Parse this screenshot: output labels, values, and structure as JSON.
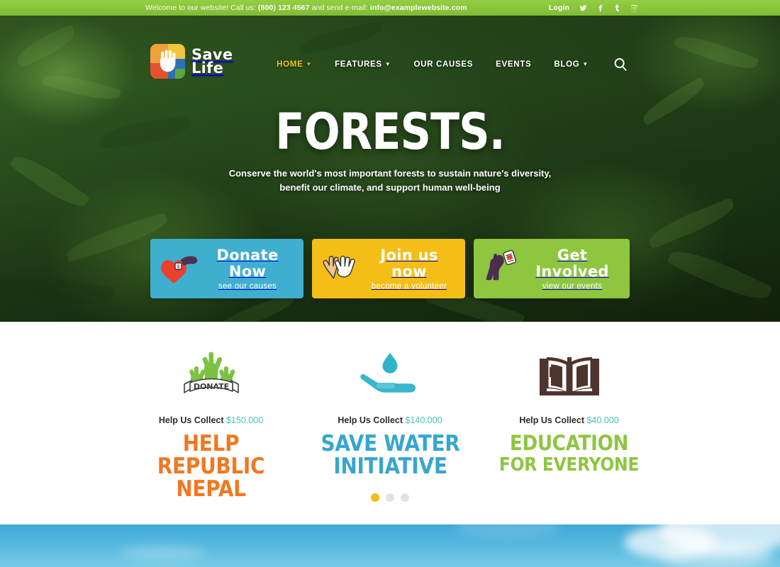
{
  "topbar": {
    "welcome_prefix": "Welcome to our website! Call us: ",
    "phone": "(800) 123 4567",
    "welcome_mid": " and send e-mail: ",
    "email": "info@examplewebsite.com",
    "login_label": "Login",
    "social": [
      {
        "name": "twitter-icon",
        "label": "Twitter"
      },
      {
        "name": "facebook-icon",
        "label": "Facebook"
      },
      {
        "name": "tumblr-icon",
        "label": "Tumblr"
      },
      {
        "name": "instagram-icon",
        "label": "Instagram"
      }
    ],
    "bg_color": "#8dc63f"
  },
  "header": {
    "logo": {
      "line1": "Save",
      "line2": "Life",
      "icon": "hand-logo-icon"
    },
    "nav": [
      {
        "label": "HOME",
        "has_dropdown": true,
        "active": true
      },
      {
        "label": "FEATURES",
        "has_dropdown": true,
        "active": false
      },
      {
        "label": "OUR CAUSES",
        "has_dropdown": false,
        "active": false
      },
      {
        "label": "EVENTS",
        "has_dropdown": false,
        "active": false
      },
      {
        "label": "BLOG",
        "has_dropdown": true,
        "active": false
      }
    ],
    "search_icon": "search-icon",
    "active_color": "#f3c518"
  },
  "hero": {
    "title": "FORESTS.",
    "subtitle_line1": "Conserve the world's most important forests to sustain nature's diversity,",
    "subtitle_line2": "benefit our climate, and support human well-being",
    "cards": [
      {
        "title": "Donate Now",
        "subtitle": "see our causes",
        "color": "#3fafd0",
        "icon": "heart-donate-icon"
      },
      {
        "title": "Join us now",
        "subtitle": "become a volunteer",
        "color": "#f5be16",
        "icon": "clapping-hands-icon"
      },
      {
        "title": "Get Involved",
        "subtitle": "view our events",
        "color": "#8ec63f",
        "icon": "dog-tag-icon"
      }
    ]
  },
  "causes": {
    "collect_label": "Help Us Collect",
    "items": [
      {
        "icon": "donate-hands-ribbon-icon",
        "amount": "$150.000",
        "title_line1": "HELP REPUBLIC",
        "title_line2": "NEPAL",
        "color": "#f07821"
      },
      {
        "icon": "hand-water-drop-icon",
        "amount": "$140.000",
        "title_line1": "SAVE WATER",
        "title_line2": "INITIATIVE",
        "color": "#37a6cf"
      },
      {
        "icon": "open-book-icon",
        "amount": "$40.000",
        "title_line1": "EDUCATION",
        "title_line2": "FOR EVERYONE",
        "color": "#8ec63f"
      }
    ],
    "carousel": {
      "total": 3,
      "active_index": 0,
      "active_color": "#f5bd15"
    }
  }
}
